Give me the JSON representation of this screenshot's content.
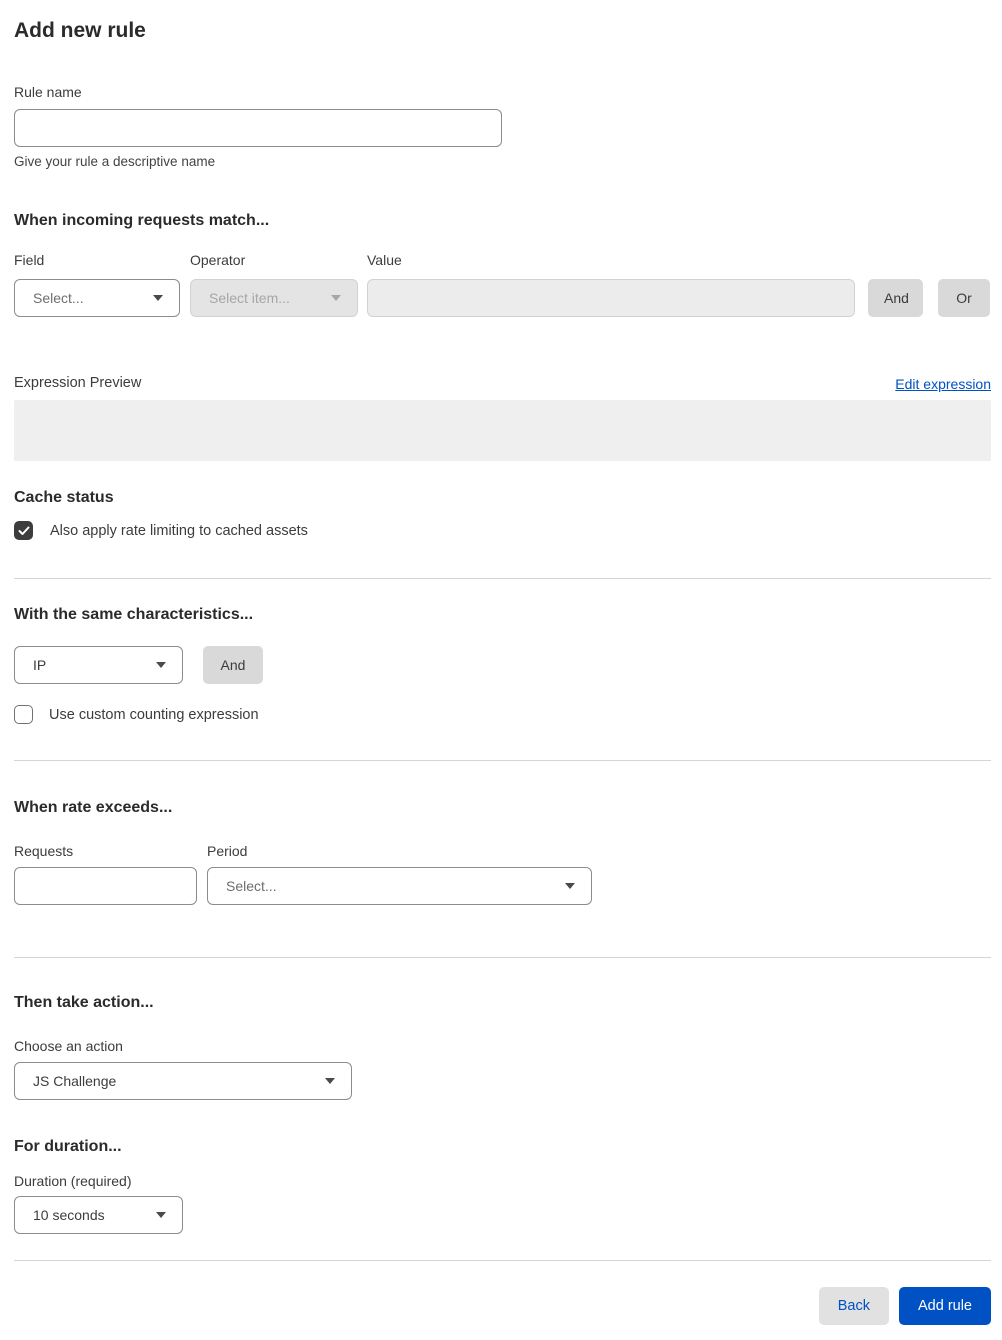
{
  "page": {
    "title": "Add new rule"
  },
  "rule_name": {
    "label": "Rule name",
    "value": "",
    "helper": "Give your rule a descriptive name"
  },
  "match_section": {
    "heading": "When incoming requests match...",
    "field": {
      "label": "Field",
      "selected": "Select..."
    },
    "operator": {
      "label": "Operator",
      "selected": "Select item...",
      "disabled": true
    },
    "value": {
      "label": "Value",
      "value": "",
      "disabled": true
    },
    "and_button": "And",
    "or_button": "Or",
    "expression_preview_label": "Expression Preview",
    "edit_expression_link": "Edit expression",
    "expression_value": ""
  },
  "cache_section": {
    "heading": "Cache status",
    "checkbox_label": "Also apply rate limiting to cached assets",
    "checked": true
  },
  "characteristics_section": {
    "heading": "With the same characteristics...",
    "characteristic_selected": "IP",
    "and_button": "And",
    "checkbox_label": "Use custom counting expression",
    "checked": false
  },
  "rate_section": {
    "heading": "When rate exceeds...",
    "requests": {
      "label": "Requests",
      "value": ""
    },
    "period": {
      "label": "Period",
      "selected": "Select..."
    }
  },
  "action_section": {
    "heading": "Then take action...",
    "choose_label": "Choose an action",
    "action_selected": "JS Challenge"
  },
  "duration_section": {
    "heading": "For duration...",
    "label": "Duration (required)",
    "duration_selected": "10 seconds"
  },
  "footer": {
    "back_button": "Back",
    "add_rule_button": "Add rule"
  },
  "colors": {
    "accent_blue": "#0051c3",
    "gray_button": "#d9d9d9",
    "disabled_bg": "#ececec",
    "preview_bg": "#efefef",
    "checkbox_dark": "#3d3d3d",
    "divider": "#d5d5d5"
  }
}
